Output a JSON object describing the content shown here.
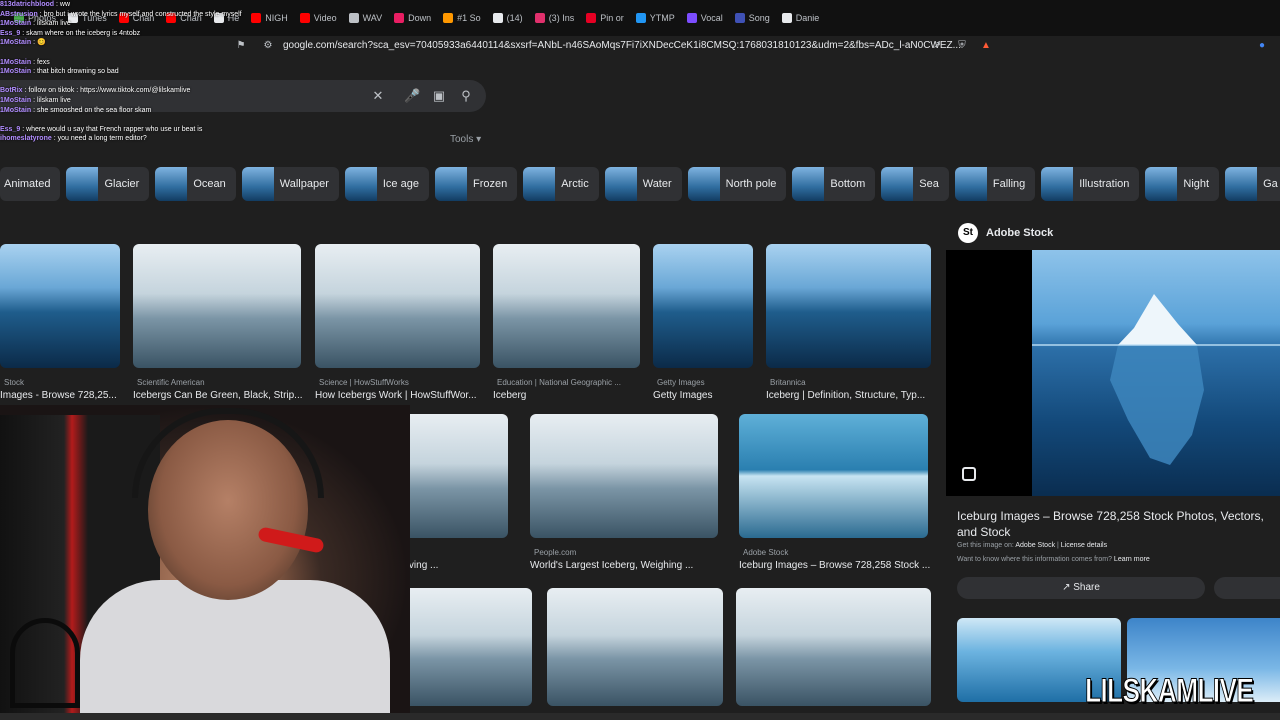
{
  "browser": {
    "tabs": [
      {
        "label": "Photos",
        "color": "#4caf50"
      },
      {
        "label": "Tunes",
        "color": "#e8eaed"
      },
      {
        "label": "Chan",
        "color": "#ff0000"
      },
      {
        "label": "Chan",
        "color": "#ff0000"
      },
      {
        "label": "He",
        "color": "#e8eaed"
      },
      {
        "label": "NIGH",
        "color": "#ff0000"
      },
      {
        "label": "Video",
        "color": "#ff0000"
      },
      {
        "label": "WAV",
        "color": "#bdc1c6"
      },
      {
        "label": "Down",
        "color": "#e91e63"
      },
      {
        "label": "#1 So",
        "color": "#ff9800"
      },
      {
        "label": "(14)",
        "color": "#e8eaed"
      },
      {
        "label": "(3) Ins",
        "color": "#e1306c"
      },
      {
        "label": "Pin or",
        "color": "#e60023"
      },
      {
        "label": "YTMP",
        "color": "#2196f3"
      },
      {
        "label": "Vocal",
        "color": "#7c4dff"
      },
      {
        "label": "Song",
        "color": "#3f51b5"
      },
      {
        "label": "Danie",
        "color": "#e8eaed"
      }
    ],
    "url": "google.com/search?sca_esv=70405933a6440114&sxsrf=ANbL-n46SAoMqs7Fi7iXNDecCeK1i8CMSQ:1768031810123&udm=2&fbs=ADc_l-aN0CWEZ..."
  },
  "search": {
    "tools_label": "Tools"
  },
  "chips": [
    "Animated",
    "Glacier",
    "Ocean",
    "Wallpaper",
    "Ice age",
    "Frozen",
    "Arctic",
    "Water",
    "North pole",
    "Bottom",
    "Sea",
    "Falling",
    "Illustration",
    "Night",
    "Ga"
  ],
  "results": [
    {
      "source": "Stock",
      "title": "Images - Browse 728,25..."
    },
    {
      "source": "Scientific American",
      "title": "Icebergs Can Be Green, Black, Strip..."
    },
    {
      "source": "Science | HowStuffWorks",
      "title": "How Icebergs Work | HowStuffWor..."
    },
    {
      "source": "Education | National Geographic ...",
      "title": "Iceberg"
    },
    {
      "source": "Getty Images",
      "title": "Getty Images"
    },
    {
      "source": "Britannica",
      "title": "Iceberg | Definition, Structure, Typ..."
    },
    {
      "source": "nica",
      "title": "- Arctic, Melting, Calving ..."
    },
    {
      "source": "People.com",
      "title": "World's Largest Iceberg, Weighing ..."
    },
    {
      "source": "Adobe Stock",
      "title": "Iceburg Images – Browse 728,258 Stock ..."
    }
  ],
  "panel": {
    "source": "Adobe Stock",
    "logo_letter": "St",
    "title": "Iceburg Images – Browse 728,258 Stock Photos, Vectors, and Stock",
    "get_image_prefix": "Get this image on:",
    "get_image_source": "Adobe Stock",
    "license_link": "License details",
    "want_to_know": "Want to know where this information comes from?",
    "learn_more": "Learn more",
    "share_label": "Share"
  },
  "chat": [
    {
      "user": "813datrichblood",
      "msg": "ww"
    },
    {
      "user": "ABstrusion",
      "msg": "bro but i wrote the lyrics myself and constructed the style myself"
    },
    {
      "user": "1MoStain",
      "msg": "lilskam live"
    },
    {
      "user": "Ess_9",
      "msg": "skam where on the iceberg is 4ntobz"
    },
    {
      "user": "1MoStain",
      "msg": "😊"
    },
    {
      "user": "",
      "msg": ""
    },
    {
      "user": "1MoStain",
      "msg": "fexs"
    },
    {
      "user": "1MoStain",
      "msg": "that bitch drowning so bad"
    },
    {
      "user": "",
      "msg": ""
    },
    {
      "user": "BotRix",
      "msg": "follow on tiktok : https://www.tiktok.com/@lilskamlive"
    },
    {
      "user": "1MoStain",
      "msg": "lilskam live"
    },
    {
      "user": "1MoStain",
      "msg": "she smooshed on the sea floor skam"
    },
    {
      "user": "",
      "msg": ""
    },
    {
      "user": "Ess_9",
      "msg": "where would u say that French rapper who use ur beat is"
    },
    {
      "user": "ihomeslatyrone",
      "msg": "you need a long term editor?"
    }
  ],
  "watermark": "LILSKAMLIVE"
}
